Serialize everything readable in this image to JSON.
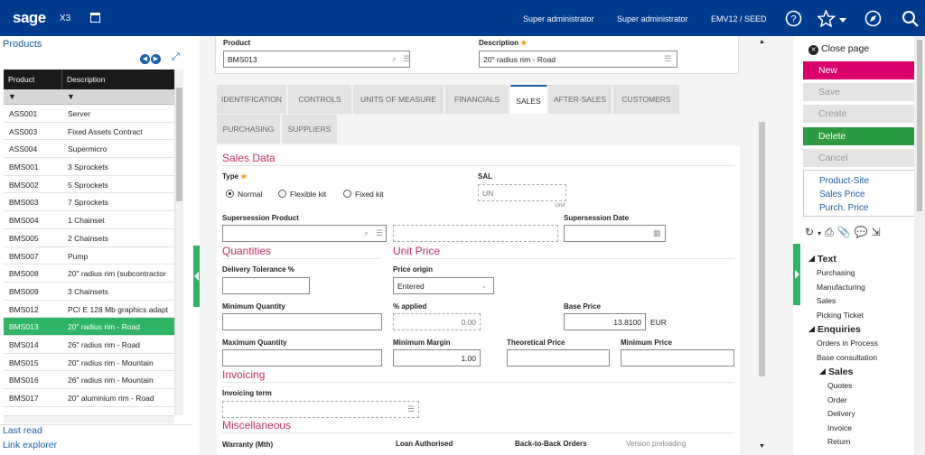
{
  "topbar": {
    "brand": "sage",
    "product": "X3",
    "user1": "Super administrator",
    "user2": "Super administrator",
    "folder": "EMV12 / SEED"
  },
  "left_panel": {
    "title": "Products",
    "columns": [
      "Product",
      "Description"
    ],
    "filter_icon": "▼",
    "rows": [
      {
        "product": "ASS001",
        "description": "Server"
      },
      {
        "product": "ASS003",
        "description": "Fixed Assets Contract"
      },
      {
        "product": "ASS004",
        "description": "Supermicro"
      },
      {
        "product": "BMS001",
        "description": "3 Sprockets"
      },
      {
        "product": "BMS002",
        "description": "5 Sprockets"
      },
      {
        "product": "BMS003",
        "description": "7 Sprockets"
      },
      {
        "product": "BMS004",
        "description": "1 Chainset"
      },
      {
        "product": "BMS005",
        "description": "2 Chainsets"
      },
      {
        "product": "BMS007",
        "description": "Pump"
      },
      {
        "product": "BMS008",
        "description": "20\" radius rim (subcontractor"
      },
      {
        "product": "BMS009",
        "description": "3 Chainsets"
      },
      {
        "product": "BMS012",
        "description": "PCI E 128 Mb graphics adapt"
      },
      {
        "product": "BMS013",
        "description": "20\" radius rim - Road"
      },
      {
        "product": "BMS014",
        "description": "26\" radius rim - Road"
      },
      {
        "product": "BMS015",
        "description": "20\" radius rim - Mountain"
      },
      {
        "product": "BMS016",
        "description": "26\" radius rim - Mountain"
      },
      {
        "product": "BMS017",
        "description": "20\" aluminium rim - Road"
      }
    ],
    "selected_index": 12,
    "last_read": "Last read",
    "link_explorer": "Link explorer"
  },
  "header": {
    "product_label": "Product",
    "product_value": "BMS013",
    "description_label": "Description",
    "description_value": "20\" radius rim - Road"
  },
  "tabs": [
    "IDENTIFICATION",
    "CONTROLS",
    "UNITS OF MEASURE",
    "FINANCIALS",
    "SALES",
    "AFTER-SALES",
    "CUSTOMERS",
    "PURCHASING",
    "SUPPLIERS"
  ],
  "active_tab": "SALES",
  "form": {
    "sales_data": "Sales Data",
    "type_label": "Type",
    "type_options": [
      "Normal",
      "Flexible kit",
      "Fixed kit"
    ],
    "type_selected": "Normal",
    "sal_label": "SAL",
    "sal_value": "UN",
    "unit_caption": "Unit",
    "supersession_product_label": "Supersession Product",
    "supersession_date_label": "Supersession Date",
    "quantities": "Quantities",
    "unit_price": "Unit Price",
    "delivery_tolerance_label": "Delivery Tolerance %",
    "price_origin_label": "Price origin",
    "price_origin_value": "Entered",
    "min_quantity_label": "Minimum Quantity",
    "pct_applied_label": "% applied",
    "pct_applied_value": "0.00",
    "base_price_label": "Base Price",
    "base_price_value": "13.8100",
    "currency": "EUR",
    "max_quantity_label": "Maximum Quantity",
    "min_margin_label": "Minimum Margin",
    "min_margin_value": "1.00",
    "theoretical_price_label": "Theoretical Price",
    "minimum_price_label": "Minimum Price",
    "invoicing": "Invoicing",
    "invoicing_term_label": "Invoicing term",
    "miscellaneous": "Miscellaneous",
    "warranty_label": "Warranty (Mth)",
    "loan_label": "Loan Authorised",
    "b2b_label": "Back-to-Back Orders",
    "version_label": "Version preloading"
  },
  "right_panel": {
    "close": "Close page",
    "buttons": [
      {
        "label": "New",
        "bg": "#d9006c",
        "fg": "#ffffff"
      },
      {
        "label": "Save",
        "bg": "#e4e4e4",
        "fg": "#9a9a9a"
      },
      {
        "label": "Create",
        "bg": "#e4e4e4",
        "fg": "#9a9a9a"
      },
      {
        "label": "Delete",
        "bg": "#2c9a43",
        "fg": "#ffffff"
      },
      {
        "label": "Cancel",
        "bg": "#e4e4e4",
        "fg": "#9a9a9a"
      }
    ],
    "links": [
      "Product-Site",
      "Sales Price",
      "Purch. Price"
    ],
    "text_header": "Text",
    "text_items": [
      "Purchasing",
      "Manufacturing",
      "Sales",
      "Picking Ticket"
    ],
    "enquiries_header": "Enquiries",
    "enquiry_items": [
      "Orders in Process",
      "Base consultation"
    ],
    "sales_header": "Sales",
    "sales_items": [
      "Quotes",
      "Order",
      "Delivery",
      "Invoice",
      "Return"
    ]
  }
}
